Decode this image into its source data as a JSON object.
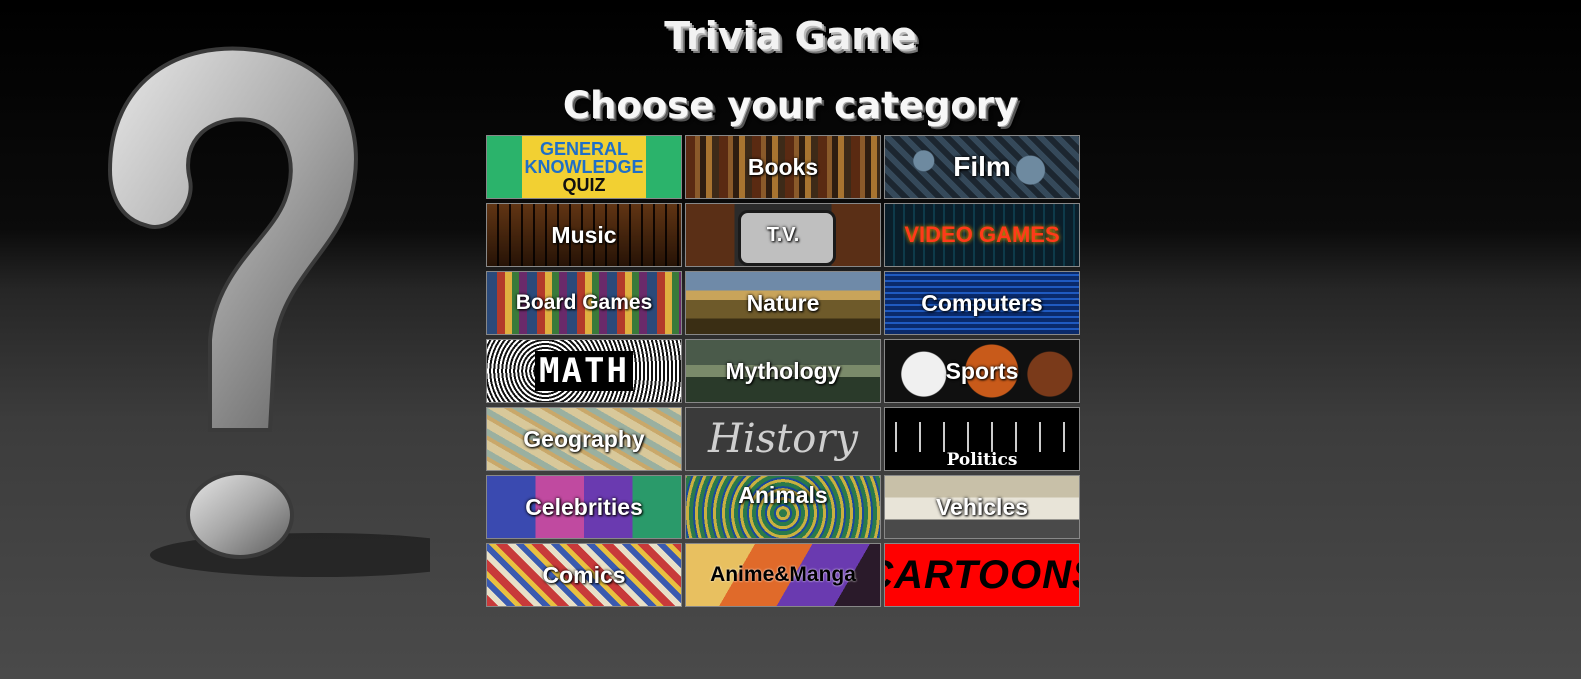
{
  "header": {
    "title": "Trivia Game",
    "subtitle": "Choose your category"
  },
  "categories": [
    {
      "label": "GENERAL",
      "label2": "KNOWLEDGE",
      "label3": "QUIZ"
    },
    {
      "label": "Books"
    },
    {
      "label": "Film"
    },
    {
      "label": "Music"
    },
    {
      "label": "T.V."
    },
    {
      "label": "VIDEO GAMES"
    },
    {
      "label": "Board Games"
    },
    {
      "label": "Nature"
    },
    {
      "label": "Computers"
    },
    {
      "label": "MATH"
    },
    {
      "label": "Mythology"
    },
    {
      "label": "Sports"
    },
    {
      "label": "Geography"
    },
    {
      "label": "History"
    },
    {
      "label": "Politics"
    },
    {
      "label": "Celebrities"
    },
    {
      "label": "Animals"
    },
    {
      "label": "Vehicles"
    },
    {
      "label": "Comics"
    },
    {
      "label": "Anime&Manga"
    },
    {
      "label": "CARTOONS"
    }
  ]
}
